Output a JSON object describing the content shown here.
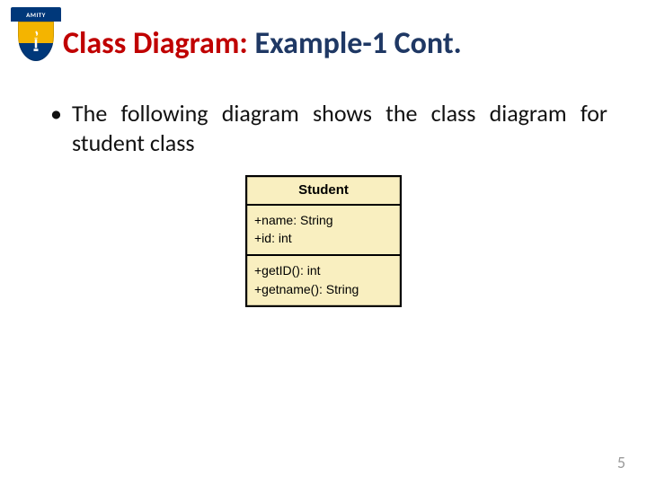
{
  "logo": {
    "banner_text": "AMITY"
  },
  "title": {
    "part1": "Class Diagram:",
    "part2": " Example-1 Cont."
  },
  "body": {
    "bullet_text": "The following diagram shows the class diagram for student class"
  },
  "uml": {
    "class_name": "Student",
    "attributes": [
      "+name: String",
      "+id: int"
    ],
    "operations": [
      "+getID(): int",
      "+getname(): String"
    ]
  },
  "page_number": "5"
}
